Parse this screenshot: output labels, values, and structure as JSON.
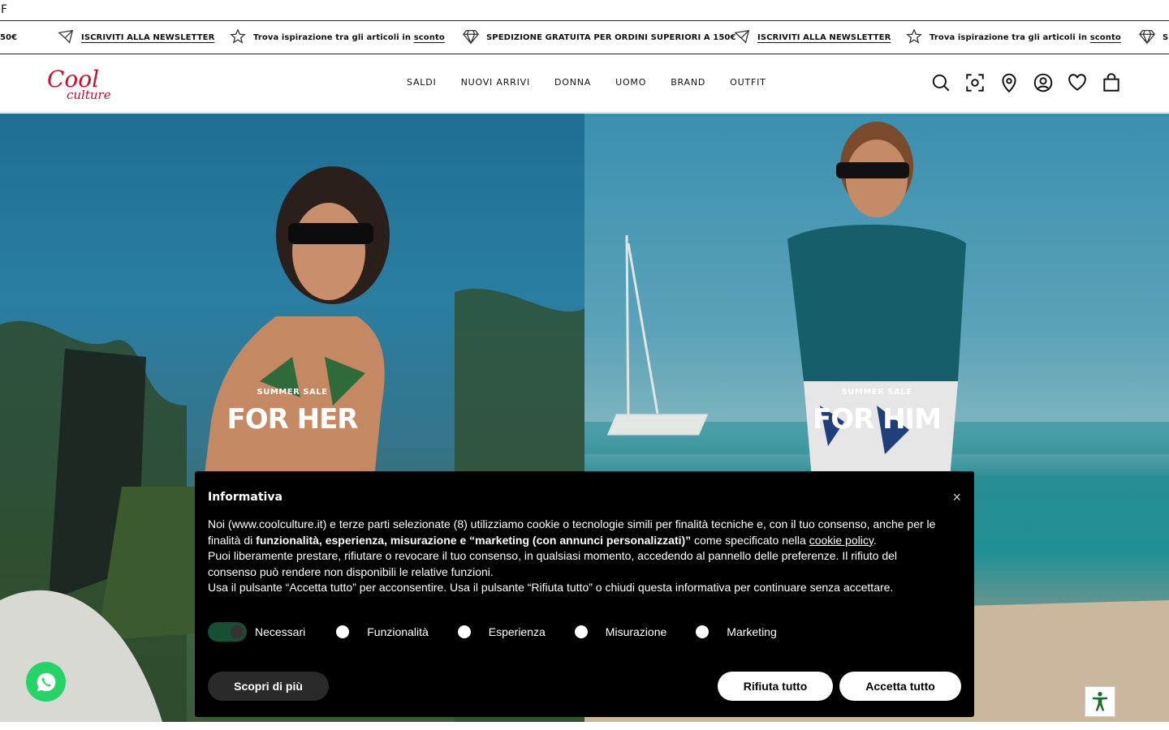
{
  "top_strip": {
    "text": "F"
  },
  "ticker": {
    "items": [
      {
        "icon": "diamond-icon",
        "text": "50€"
      },
      {
        "icon": "envelope-icon",
        "text": "ISCRIVITI ALLA NEWSLETTER"
      },
      {
        "icon": "star-icon",
        "text": "Trova ispirazione tra gli articoli in",
        "link": "sconto"
      },
      {
        "icon": "diamond-icon",
        "text": "SPEDIZIONE GRATUITA PER ORDINI SUPERIORI A 150€"
      },
      {
        "icon": "envelope-icon",
        "text": "ISCRIVITI ALLA NEWSLETTER"
      },
      {
        "icon": "star-icon",
        "text": "Trova ispirazione tra gli articoli in",
        "link": "sconto"
      },
      {
        "icon": "diamond-icon",
        "text": "SI"
      }
    ]
  },
  "header": {
    "logo_text": "Cool culture",
    "nav": [
      "SALDI",
      "NUOVI ARRIVI",
      "DONNA",
      "UOMO",
      "BRAND",
      "OUTFIT"
    ],
    "icons": [
      "search-icon",
      "visual-search-icon",
      "store-locator-icon",
      "account-icon",
      "wishlist-icon",
      "cart-icon"
    ]
  },
  "hero": {
    "left": {
      "kicker": "SUMMER SALE",
      "title": "FOR HER"
    },
    "right": {
      "kicker": "SUMMER SALE",
      "title": "FOR HIM"
    }
  },
  "cookie": {
    "title": "Informativa",
    "close": "×",
    "body_1": "Noi (www.coolculture.it) e terze parti selezionate (8) utilizziamo cookie o tecnologie simili per finalità tecniche e, con il tuo consenso, anche per le finalità di",
    "body_bold": "funzionalità, esperienza, misurazione e “marketing (con annunci personalizzati)”",
    "body_2": "come specificato nella",
    "body_link": "cookie policy",
    "body_3": "Puoi liberamente prestare, rifiutare o revocare il tuo consenso, in qualsiasi momento, accedendo al pannello delle preferenze. Il rifiuto del consenso può rendere non disponibili le relative funzioni.",
    "body_4": "Usa il pulsante “Accetta tutto” per acconsentire. Usa il pulsante “Rifiuta tutto” o chiudi questa informativa per continuare senza accettare.",
    "toggles": [
      {
        "label": "Necessari",
        "checked": true
      },
      {
        "label": "Funzionalità",
        "checked": false
      },
      {
        "label": "Esperienza",
        "checked": false
      },
      {
        "label": "Misurazione",
        "checked": false
      },
      {
        "label": "Marketing",
        "checked": false
      }
    ],
    "btn_more": "Scopri di più",
    "btn_reject": "Rifiuta tutto",
    "btn_accept": "Accetta tutto"
  },
  "colors": {
    "accent_red": "#c8102e",
    "whatsapp": "#25d366",
    "toggle_on": "#174f35"
  }
}
